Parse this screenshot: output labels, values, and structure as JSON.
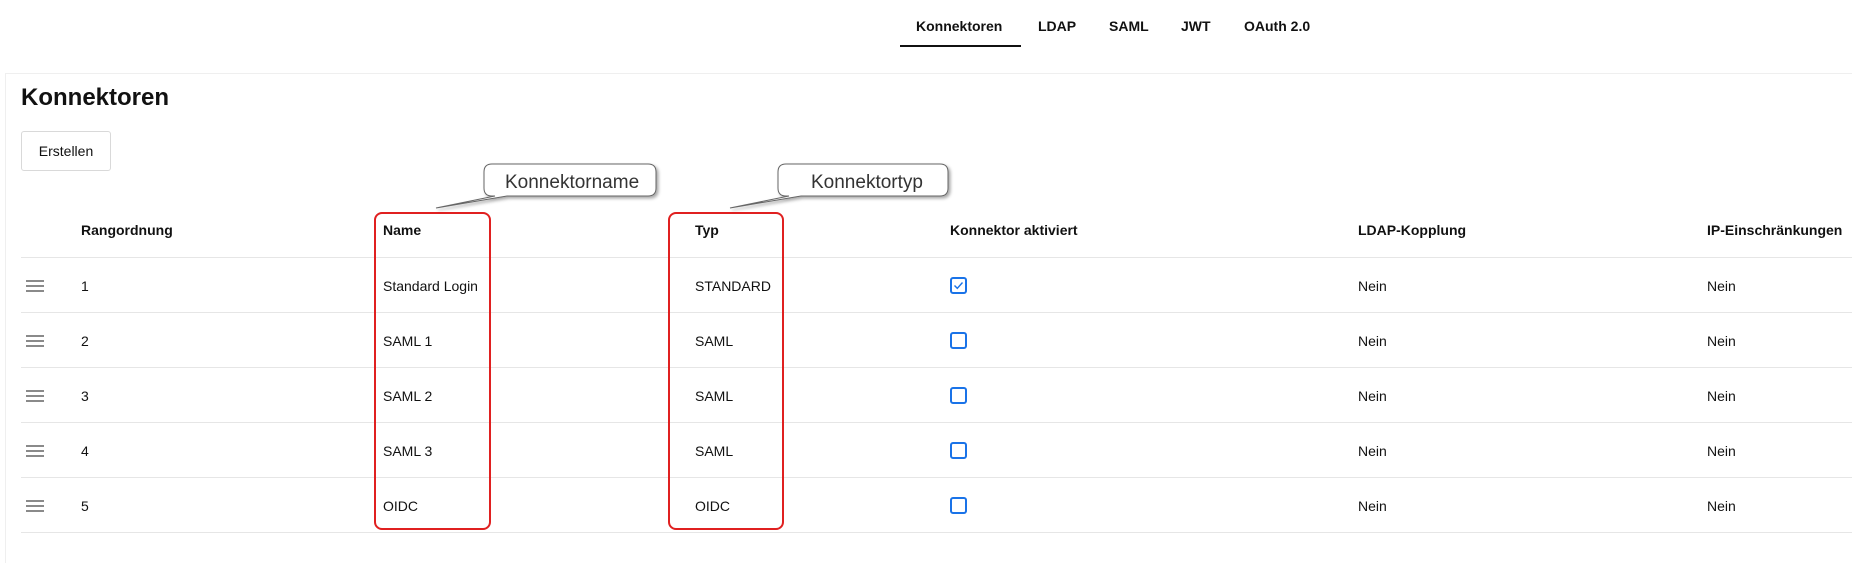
{
  "nav": {
    "tabs": [
      {
        "label": "Konnektoren"
      },
      {
        "label": "LDAP"
      },
      {
        "label": "SAML"
      },
      {
        "label": "JWT"
      },
      {
        "label": "OAuth 2.0"
      }
    ],
    "active_tab": "Konnektoren"
  },
  "page": {
    "title": "Konnektoren",
    "create_button": "Erstellen"
  },
  "table": {
    "headers": {
      "rank": "Rangordnung",
      "name": "Name",
      "type": "Typ",
      "enabled": "Konnektor aktiviert",
      "ldap": "LDAP-Kopplung",
      "ip": "IP-Einschränkungen"
    },
    "rows": [
      {
        "rank": "1",
        "name": "Standard Login",
        "type": "STANDARD",
        "enabled": true,
        "ldap": "Nein",
        "ip": "Nein"
      },
      {
        "rank": "2",
        "name": "SAML 1",
        "type": "SAML",
        "enabled": false,
        "ldap": "Nein",
        "ip": "Nein"
      },
      {
        "rank": "3",
        "name": "SAML 2",
        "type": "SAML",
        "enabled": false,
        "ldap": "Nein",
        "ip": "Nein"
      },
      {
        "rank": "4",
        "name": "SAML 3",
        "type": "SAML",
        "enabled": false,
        "ldap": "Nein",
        "ip": "Nein"
      },
      {
        "rank": "5",
        "name": "OIDC",
        "type": "OIDC",
        "enabled": false,
        "ldap": "Nein",
        "ip": "Nein"
      }
    ]
  },
  "annotations": {
    "name_callout": "Konnektorname",
    "type_callout": "Konnektortyp"
  },
  "colors": {
    "highlight": "#e02020",
    "checkbox_accent": "#1a73e8"
  }
}
